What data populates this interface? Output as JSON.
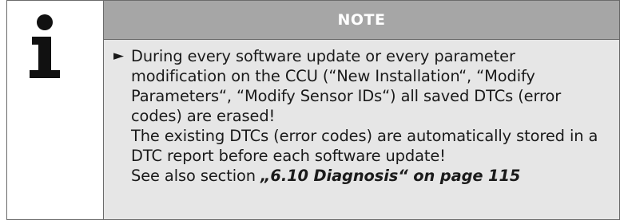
{
  "note": {
    "icon": "info-i-icon",
    "title": "NOTE",
    "bullet_symbol": "►",
    "paragraph1": "During every software update or every parameter modification on the CCU (“New Installation“, “Modify Parameters“, “Modify Sensor IDs“) all saved DTCs (error codes) are erased!",
    "paragraph2": "The existing DTCs (error codes) are automatically stored in a DTC report before each software update!",
    "see_also_prefix": "See also section ",
    "see_also_ref": "„6.10 Diagnosis“ on page 115"
  }
}
